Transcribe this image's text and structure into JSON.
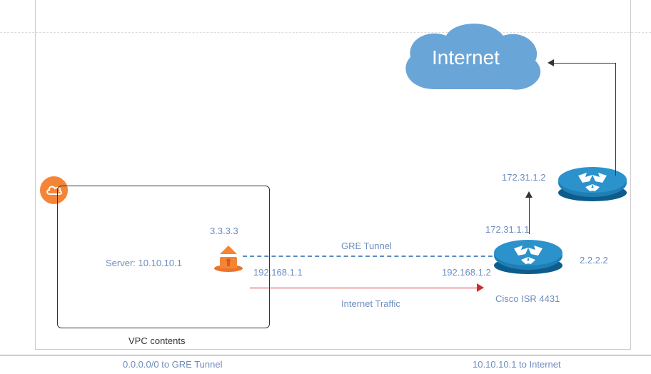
{
  "internet": {
    "label": "Internet"
  },
  "vpc": {
    "label": "VPC contents",
    "server_label": "Server: 10.10.10.1",
    "gateway_ip": "3.3.3.3",
    "tunnel_endpoint": "192.168.1.1"
  },
  "gre": {
    "label": "GRE Tunnel"
  },
  "traffic": {
    "label": "Internet Traffic"
  },
  "router_main": {
    "label": "Cisco ISR 4431",
    "left_ip": "192.168.1.2",
    "right_ip": "2.2.2.2",
    "up_ip": "172.31.1.1"
  },
  "router_upstream": {
    "left_ip": "172.31.1.2"
  },
  "routes": {
    "left": "0.0.0.0/0 to GRE Tunnel",
    "right": "10.10.10.1 to Internet"
  }
}
